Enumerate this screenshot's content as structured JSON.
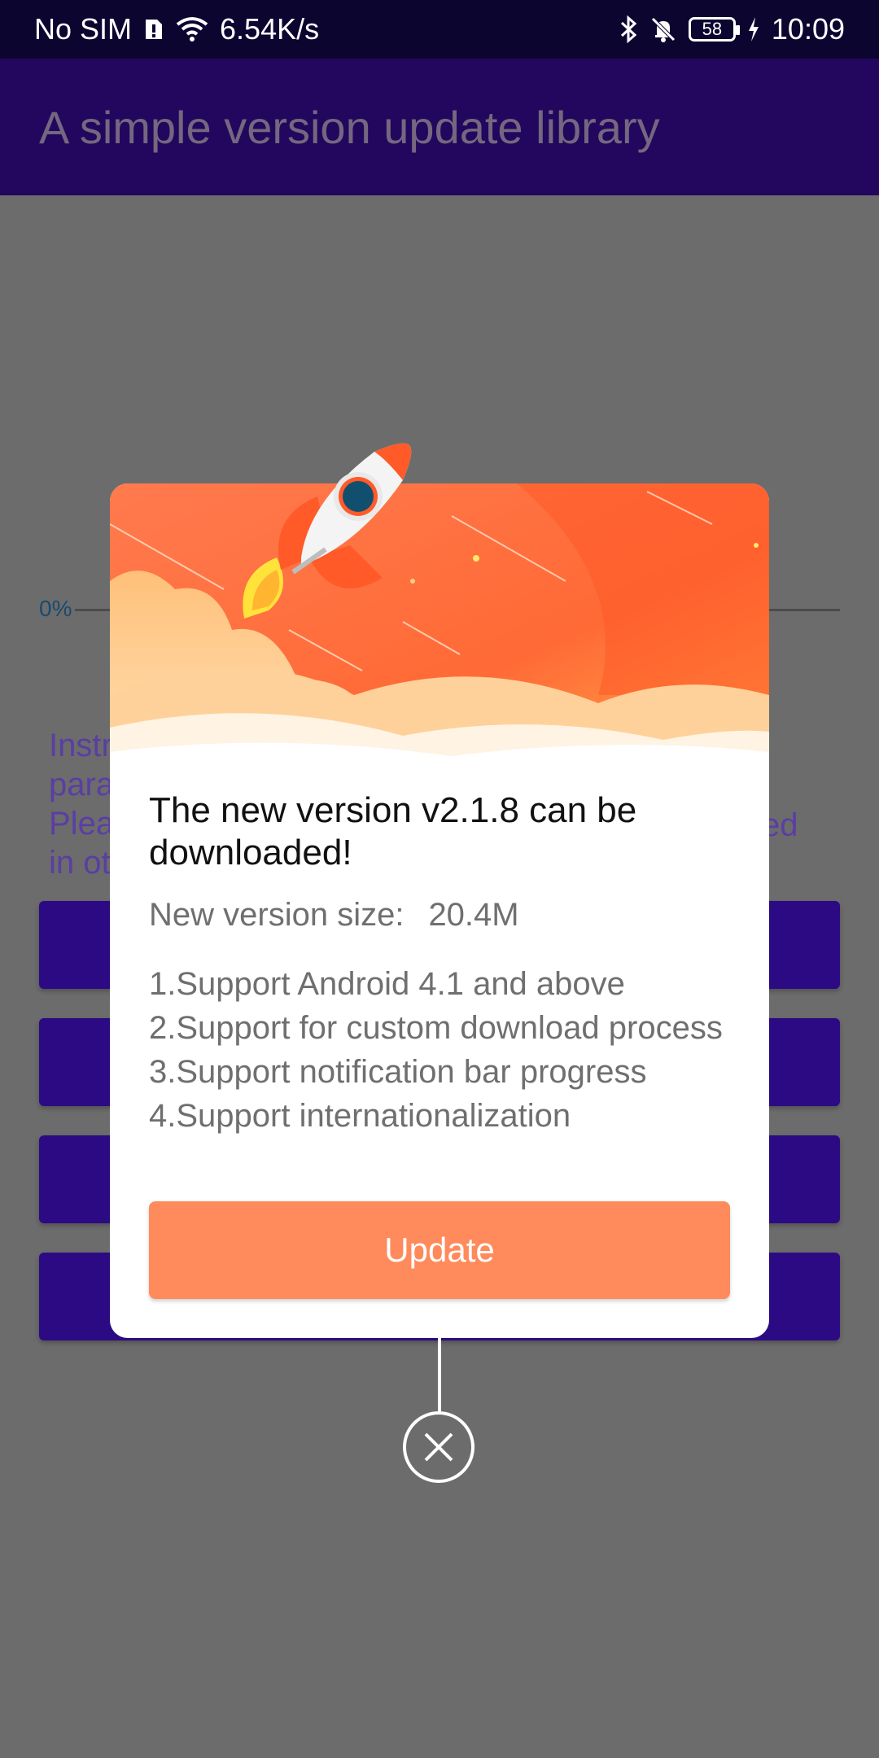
{
  "status_bar": {
    "carrier": "No SIM",
    "net_speed": "6.54K/s",
    "battery": "58",
    "time": "10:09"
  },
  "app_bar": {
    "title": "A simple version update library"
  },
  "background": {
    "progress_label": "0%",
    "instructions_lines": [
      "Instr",
      "para",
      "Plea",
      "in ot"
    ],
    "instructions_trail": "ed"
  },
  "dialog": {
    "title": "The new version v2.1.8 can be downloaded!",
    "size_label": "New version size:",
    "size_value": "20.4M",
    "notes": [
      "1.Support Android 4.1 and above",
      "2.Support for custom download process",
      "3.Support notification bar progress",
      "4.Support internationalization"
    ],
    "update_label": "Update"
  },
  "colors": {
    "accent": "#ff8a5c",
    "app_bar": "#23075e",
    "status_bar": "#0b0530",
    "overlay": "#6c6c6c"
  },
  "icons": [
    "bluetooth-icon",
    "mute-icon",
    "wifi-icon",
    "charging-icon",
    "close-icon",
    "rocket-icon"
  ]
}
